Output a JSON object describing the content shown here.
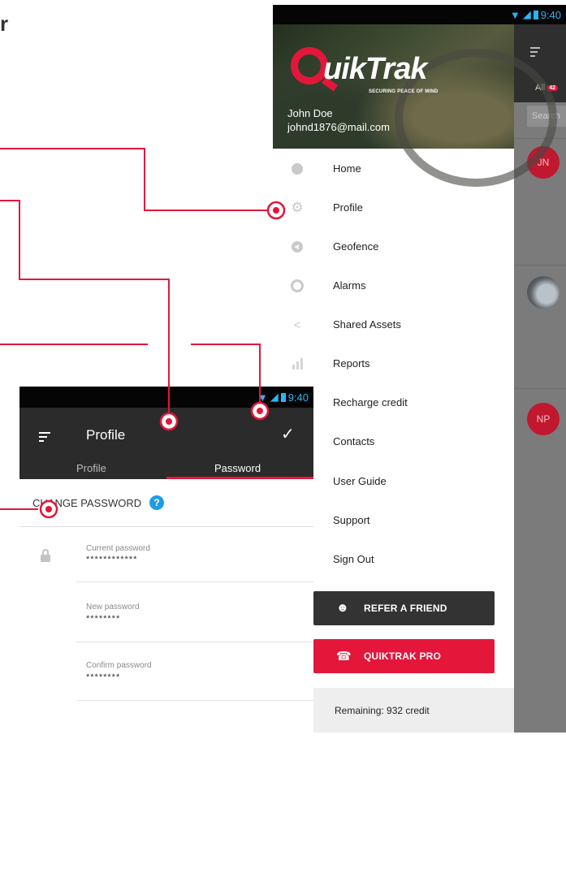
{
  "heading_fragment": "r",
  "status_bar": {
    "time": "9:40"
  },
  "drawer": {
    "logo": {
      "word": "uikTrak",
      "tagline": "SECURING PEACE OF MIND"
    },
    "user": {
      "name": "John Doe",
      "email": "johnd1876@mail.com"
    },
    "menu": [
      {
        "label": "Home",
        "icon": "home-icon"
      },
      {
        "label": "Profile",
        "icon": "gear-icon"
      },
      {
        "label": "Geofence",
        "icon": "navigation-icon"
      },
      {
        "label": "Alarms",
        "icon": "alarm-icon"
      },
      {
        "label": "Shared Assets",
        "icon": "share-icon"
      },
      {
        "label": "Reports",
        "icon": "bar-chart-icon"
      },
      {
        "label": "Recharge credit",
        "icon": ""
      },
      {
        "label": "Contacts",
        "icon": ""
      },
      {
        "label": "User Guide",
        "icon": ""
      },
      {
        "label": "Support",
        "icon": ""
      },
      {
        "label": "Sign Out",
        "icon": ""
      }
    ],
    "refer_button": "REFER A FRIEND",
    "pro_button": "QUIKTRAK PRO",
    "remaining": "Remaining: 932 credit"
  },
  "background_app": {
    "tab_label": "All",
    "tab_badge": "42",
    "search_placeholder": "Search",
    "avatars": [
      "JN",
      "NP"
    ]
  },
  "profile_screen": {
    "title": "Profile",
    "tabs": [
      "Profile",
      "Password"
    ],
    "active_tab": "Password",
    "section_title": "CHANGE PASSWORD",
    "help_glyph": "?",
    "fields": [
      {
        "label": "Current password",
        "value": "************"
      },
      {
        "label": "New password",
        "value": "********"
      },
      {
        "label": "Confirm password",
        "value": "********"
      }
    ]
  },
  "colors": {
    "accent": "#e4163a",
    "dark_bar": "#2b2b2b",
    "status_icons": "#29b6f6",
    "help": "#1e9de3"
  }
}
